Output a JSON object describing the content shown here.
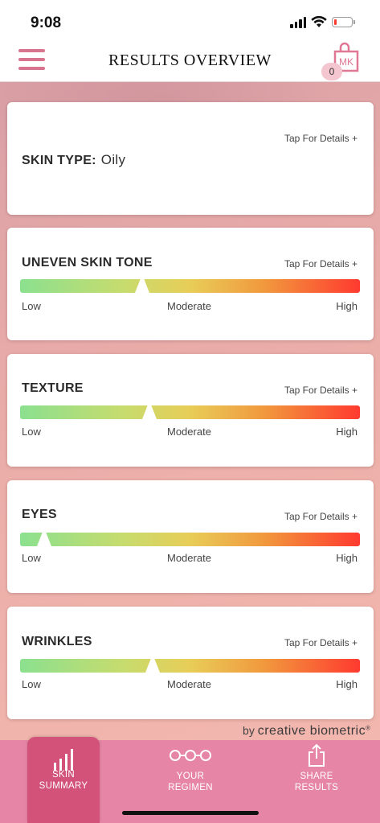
{
  "status_bar": {
    "time": "9:08"
  },
  "header": {
    "title": "RESULTS OVERVIEW",
    "cart_logo_text": "MK",
    "cart_count": "0"
  },
  "skin_type": {
    "label": "SKIN TYPE:",
    "value": "Oily",
    "link": "Tap For Details +"
  },
  "metrics": [
    {
      "title": "UNEVEN SKIN TONE",
      "link": "Tap For Details +",
      "level": 0.36
    },
    {
      "title": "TEXTURE",
      "link": "Tap For Details +",
      "level": 0.38
    },
    {
      "title": "EYES",
      "link": "Tap For Details +",
      "level": 0.07
    },
    {
      "title": "WRINKLES",
      "link": "Tap For Details +",
      "level": 0.39
    }
  ],
  "scale": {
    "low": "Low",
    "moderate": "Moderate",
    "high": "High"
  },
  "credit": {
    "prefix": "by",
    "brand": "creative biometric",
    "mark": "®"
  },
  "nav": {
    "items": [
      {
        "line1": "SKIN",
        "line2": "SUMMARY",
        "icon": "bar-chart-icon",
        "active": true
      },
      {
        "line1": "YOUR",
        "line2": "REGIMEN",
        "icon": "regimen-icon",
        "active": false
      },
      {
        "line1": "SHARE",
        "line2": "RESULTS",
        "icon": "share-icon",
        "active": false
      }
    ]
  },
  "colors": {
    "accent": "#d9748f",
    "nav_background": "#e685a6",
    "nav_active": "#d2527a"
  }
}
